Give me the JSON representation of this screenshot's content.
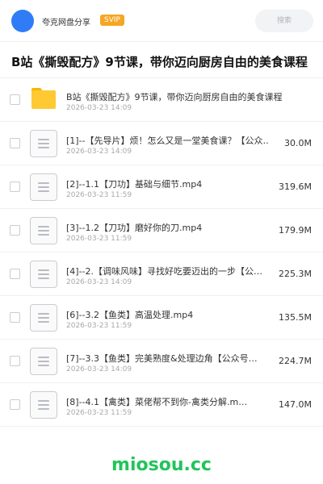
{
  "header": {
    "user_name": "夸克网盘分享",
    "badge": "SVIP",
    "search_placeholder": "搜索"
  },
  "page": {
    "title": "B站《撕毁配方》9节课，带你迈向厨房自由的美食课程"
  },
  "files": [
    {
      "type": "folder",
      "name": "B站《撕毁配方》9节课，带你迈向厨房自由的美食课程",
      "date": "2026-03-23 14:09",
      "size": ""
    },
    {
      "type": "file",
      "name": "[1]--【先导片】烦！怎么又是一堂美食课？【公众…",
      "date": "2026-03-23 14:09",
      "size": "30.0M"
    },
    {
      "type": "file",
      "name": "[2]--1.1【刀功】基础与细节.mp4",
      "date": "2026-03-23 11:59",
      "size": "319.6M"
    },
    {
      "type": "file",
      "name": "[3]--1.2【刀功】磨好你的刀.mp4",
      "date": "2026-03-23 11:59",
      "size": "179.9M"
    },
    {
      "type": "file",
      "name": "[4]--2.【调味风味】寻找好吃要迈出的一步【公…",
      "date": "2026-03-23 14:09",
      "size": "225.3M"
    },
    {
      "type": "file",
      "name": "[6]--3.2【鱼类】高温处理.mp4",
      "date": "2026-03-23 11:59",
      "size": "135.5M"
    },
    {
      "type": "file",
      "name": "[7]--3.3【鱼类】完美熟度&处理边角【公众号…",
      "date": "2026-03-23 14:09",
      "size": "224.7M"
    },
    {
      "type": "file",
      "name": "[8]--4.1【禽类】菜佬帮不到你-禽类分解.m…",
      "date": "2026-03-23 11:59",
      "size": "147.0M"
    }
  ],
  "watermark": "miosou.cc",
  "colors": {
    "avatar": "#2f7cf6",
    "badge": "#f5a623",
    "folder": "#ffc933",
    "watermark": "#20c55a"
  }
}
